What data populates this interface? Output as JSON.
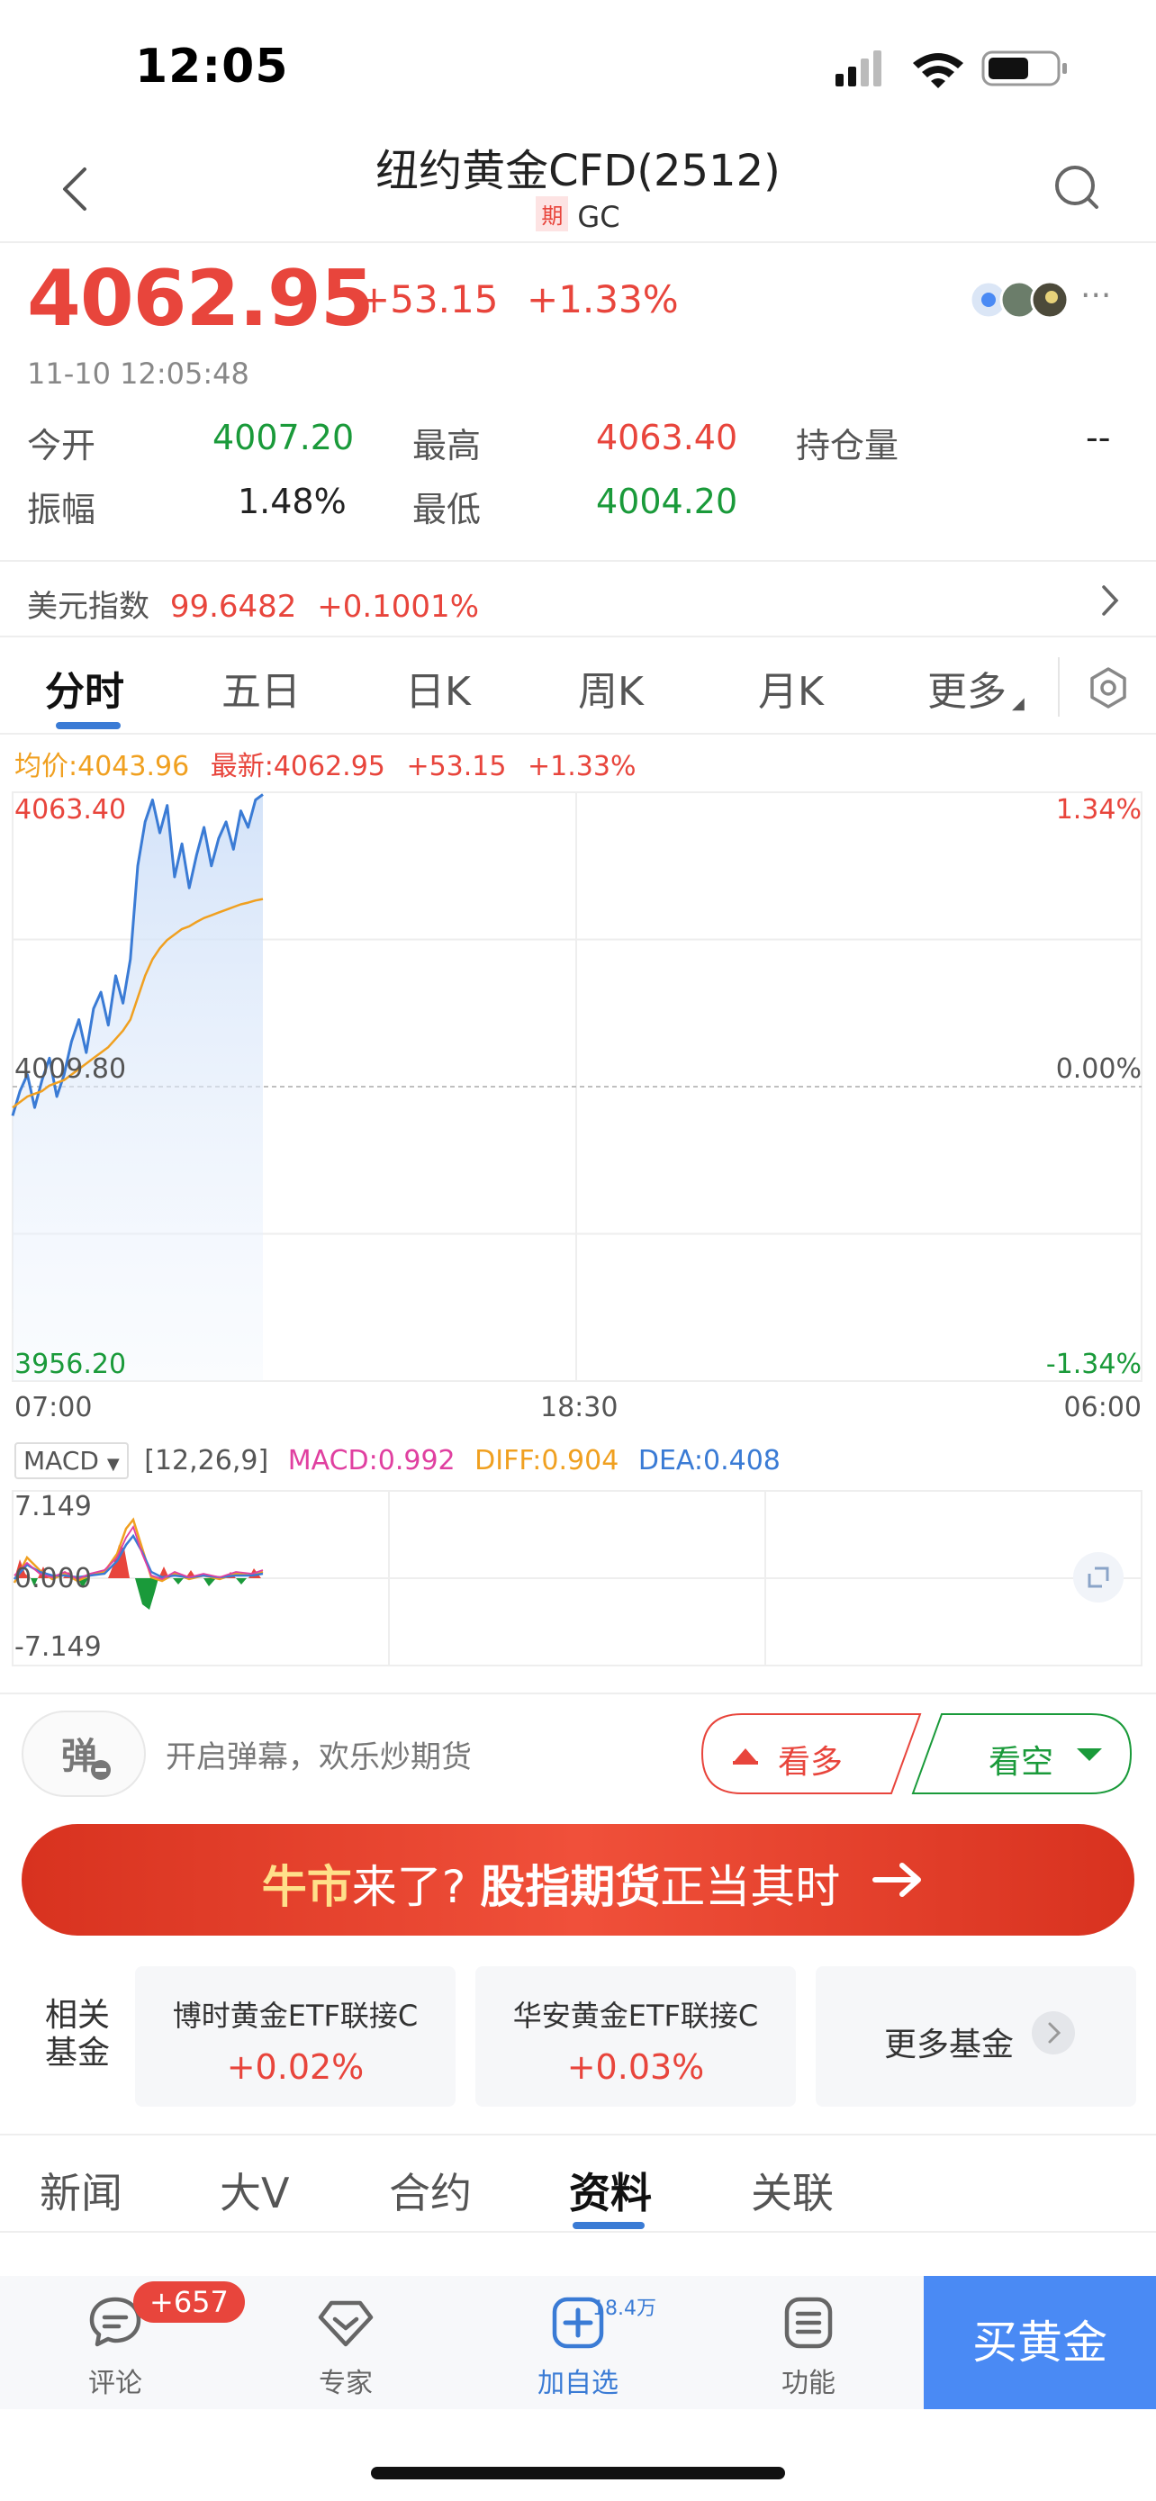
{
  "status": {
    "time": "12:05"
  },
  "nav": {
    "title": "纽约黄金CFD(2512)",
    "tag": "期",
    "code": "GC"
  },
  "quote": {
    "price": "4062.95",
    "change": "+53.15",
    "change_pct": "+1.33%",
    "time": "11-10 12:05:48",
    "more": "···"
  },
  "stats": {
    "open_label": "今开",
    "open": "4007.20",
    "high_label": "最高",
    "high": "4063.40",
    "oi_label": "持仓量",
    "oi": "--",
    "amp_label": "振幅",
    "amp": "1.48%",
    "low_label": "最低",
    "low": "4004.20"
  },
  "dxy": {
    "label": "美元指数",
    "value": "99.6482",
    "change": "+0.1001%"
  },
  "tabs": [
    "分时",
    "五日",
    "日K",
    "周K",
    "月K",
    "更多"
  ],
  "legend": {
    "avg": "均价:4043.96",
    "latest": "最新:4062.95",
    "change": "+53.15",
    "pct": "+1.33%"
  },
  "chart_data": {
    "type": "line",
    "title": "",
    "y_labels_left": [
      "4063.40",
      "4009.80",
      "3956.20"
    ],
    "y_labels_right": [
      "1.34%",
      "0.00%",
      "-1.34%"
    ],
    "x_labels": [
      "07:00",
      "18:30",
      "06:00"
    ],
    "ylim": [
      3956.2,
      4063.4
    ],
    "series": [
      {
        "color": "#3a7bd5",
        "values": [
          4004.5,
          4009,
          4012,
          4006,
          4011,
          4015,
          4008,
          4012,
          4018,
          4022,
          4016,
          4024,
          4027,
          4021,
          4030,
          4025,
          4033,
          4050,
          4058,
          4062,
          4056,
          4061,
          4048,
          4054,
          4046,
          4052,
          4057,
          4050,
          4055,
          4058,
          4053,
          4060,
          4057,
          4062,
          4063
        ]
      },
      {
        "color": "#f0a020",
        "values": [
          4006,
          4007,
          4008,
          4008.5,
          4009,
          4010,
          4010.5,
          4011,
          4012,
          4013,
          4014,
          4015,
          4016,
          4017,
          4018.5,
          4020,
          4022,
          4026,
          4030,
          4033,
          4035,
          4036.5,
          4037.5,
          4038.5,
          4039,
          4039.8,
          4040.5,
          4041,
          4041.5,
          4042,
          4042.5,
          4043,
          4043.3,
          4043.7,
          4043.96
        ]
      }
    ]
  },
  "macd": {
    "selector": "MACD",
    "params": "[12,26,9]",
    "macd": "MACD:0.992",
    "diff": "DIFF:0.904",
    "dea": "DEA:0.408",
    "y_top": "7.149",
    "y_mid": "0.000",
    "y_bottom": "-7.149"
  },
  "barrage": {
    "placeholder": "开启弹幕，欢乐炒期货",
    "bull": "看多",
    "bear": "看空"
  },
  "banner": {
    "part1": "牛市",
    "part2": "来了?",
    "part3": "股指期货",
    "part4": "正当其时"
  },
  "funds": {
    "label": "相关基金",
    "items": [
      {
        "name": "博时黄金ETF联接C",
        "change": "+0.02%"
      },
      {
        "name": "华安黄金ETF联接C",
        "change": "+0.03%"
      }
    ],
    "more": "更多基金"
  },
  "sub_tabs": [
    "新闻",
    "大V",
    "合约",
    "资料",
    "关联"
  ],
  "bottom": {
    "comment": "评论",
    "comment_badge": "+657",
    "expert": "专家",
    "watch": "加自选",
    "watch_count": "18.4万",
    "function": "功能",
    "buy": "买黄金"
  },
  "colors": {
    "up": "#e8453c",
    "down": "#1a9a3a",
    "accent": "#3a7bd5",
    "avg": "#f0a020",
    "buy": "#4a8af4"
  }
}
